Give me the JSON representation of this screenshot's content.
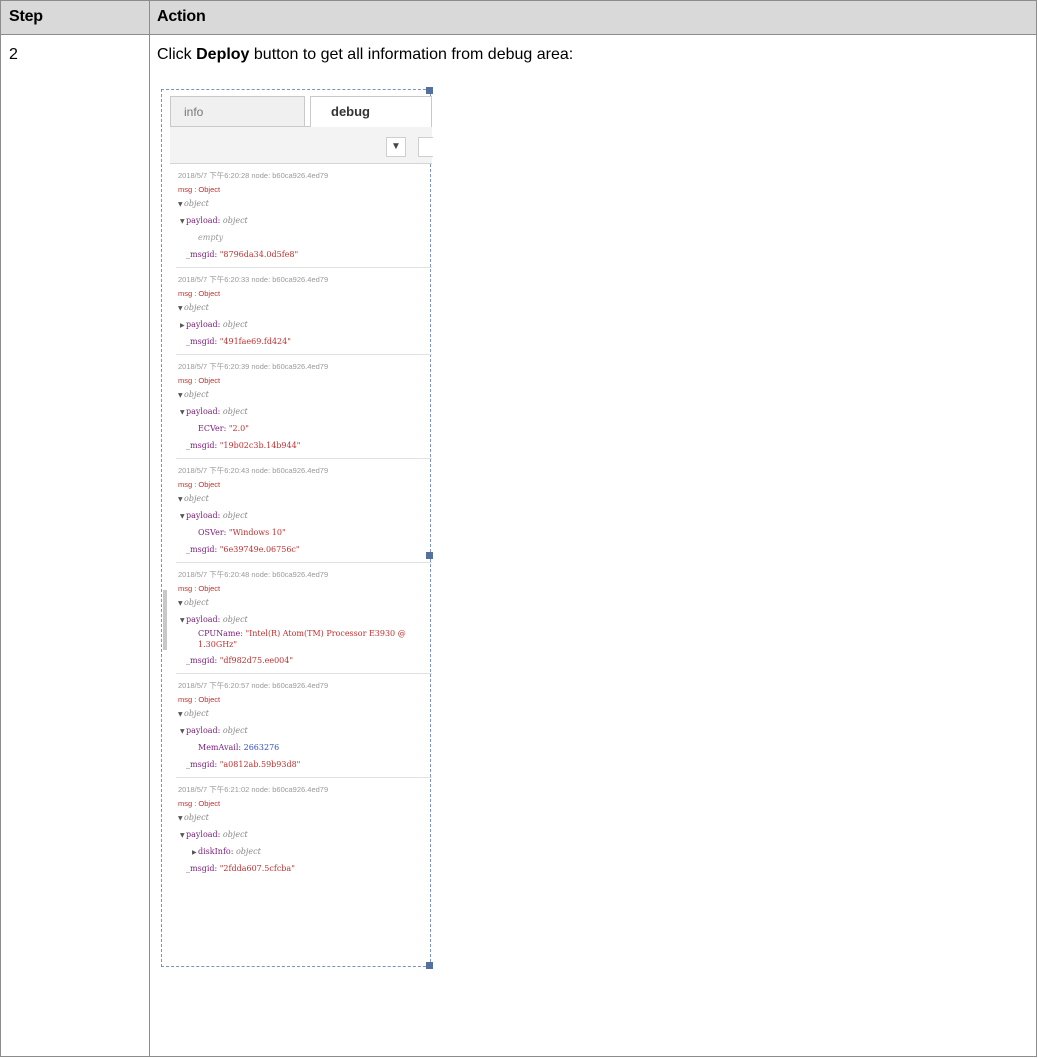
{
  "table": {
    "header": {
      "step": "Step",
      "action": "Action"
    },
    "row": {
      "step": "2",
      "action_pre": "Click ",
      "action_bold": "Deploy",
      "action_post": " button to get all information from debug area:"
    }
  },
  "debug_panel": {
    "tabs": [
      {
        "label": "info"
      },
      {
        "label": "debug"
      }
    ],
    "filter_icon": "filter-icon",
    "messages": [
      {
        "meta": "2018/5/7 下午6:20:28   node: b60ca926.4ed79",
        "type": "msg : Object",
        "root": "object",
        "payload_key": "payload:",
        "payload_type": "object",
        "child_line": "empty",
        "msgid_key": "_msgid:",
        "msgid_val": "\"8796da34.0d5fe8\""
      },
      {
        "meta": "2018/5/7 下午6:20:33   node: b60ca926.4ed79",
        "type": "msg : Object",
        "root": "object",
        "payload_key": "payload:",
        "payload_type": "object",
        "msgid_key": "_msgid:",
        "msgid_val": "\"491fae69.fd424\""
      },
      {
        "meta": "2018/5/7 下午6:20:39   node: b60ca926.4ed79",
        "type": "msg : Object",
        "root": "object",
        "payload_key": "payload:",
        "payload_type": "object",
        "child_key": "ECVer:",
        "child_val": "\"2.0\"",
        "msgid_key": "_msgid:",
        "msgid_val": "\"19b02c3b.14b944\""
      },
      {
        "meta": "2018/5/7 下午6:20:43   node: b60ca926.4ed79",
        "type": "msg : Object",
        "root": "object",
        "payload_key": "payload:",
        "payload_type": "object",
        "child_key": "OSVer:",
        "child_val": "\"Windows 10\"",
        "msgid_key": "_msgid:",
        "msgid_val": "\"6e39749e.06756c\""
      },
      {
        "meta": "2018/5/7 下午6:20:48   node: b60ca926.4ed79",
        "type": "msg : Object",
        "root": "object",
        "payload_key": "payload:",
        "payload_type": "object",
        "child_key": "CPUName:",
        "child_val": "\"Intel(R) Atom(TM) Processor E3930 @ 1.30GHz\"",
        "msgid_key": "_msgid:",
        "msgid_val": "\"df982d75.ee004\""
      },
      {
        "meta": "2018/5/7 下午6:20:57   node: b60ca926.4ed79",
        "type": "msg : Object",
        "root": "object",
        "payload_key": "payload:",
        "payload_type": "object",
        "child_key": "MemAvail:",
        "child_val": "2663276",
        "msgid_key": "_msgid:",
        "msgid_val": "\"a0812ab.59b93d8\""
      },
      {
        "meta": "2018/5/7 下午6:21:02   node: b60ca926.4ed79",
        "type": "msg : Object",
        "root": "object",
        "payload_key": "payload:",
        "payload_type": "object",
        "child_key": "diskInfo:",
        "child_val": "object",
        "msgid_key": "_msgid:",
        "msgid_val": "\"2fdda607.5cfcba\""
      }
    ]
  }
}
